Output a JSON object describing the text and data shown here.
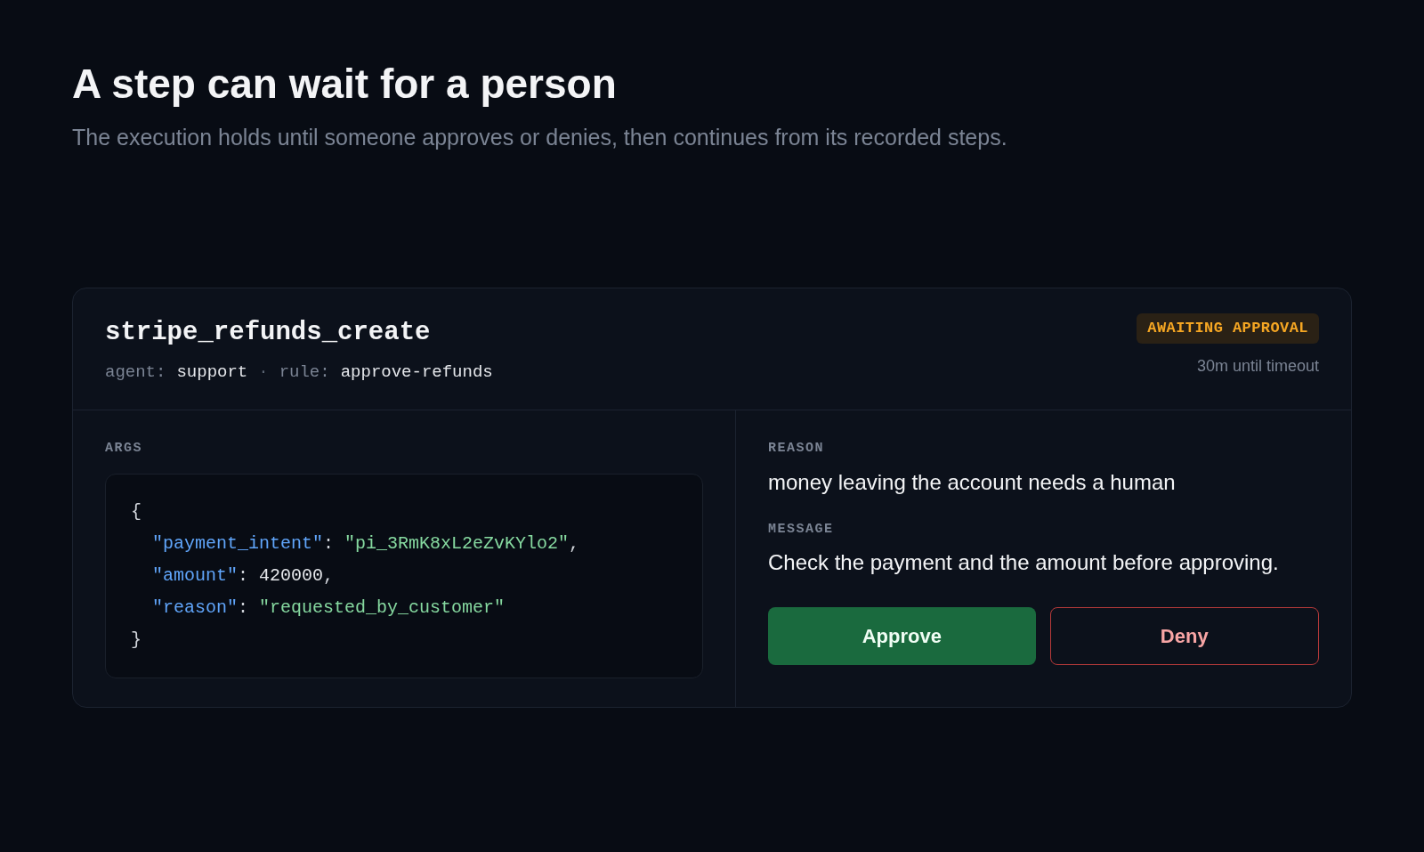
{
  "heading": "A step can wait for a person",
  "subheading": "The execution holds until someone approves or denies, then continues from its recorded steps.",
  "card": {
    "tool": "stripe_refunds_create",
    "meta": [
      {
        "label": "agent:",
        "value": "support"
      },
      {
        "label": "rule:",
        "value": "approve-refunds"
      }
    ],
    "meta_separator": "·",
    "status": {
      "label": "AWAITING APPROVAL",
      "kind": "pending"
    },
    "timeout": "30m until timeout",
    "args_label": "ARGS",
    "args_lines": [
      {
        "indent": false,
        "tokens": [
          {
            "text": "{",
            "kind": "punct"
          }
        ]
      },
      {
        "indent": true,
        "tokens": [
          {
            "text": "\"payment_intent\"",
            "kind": "key"
          },
          {
            "text": ": ",
            "kind": "punct"
          },
          {
            "text": "\"pi_3RmK8xL2eZvKYlo2\"",
            "kind": "string"
          },
          {
            "text": ",",
            "kind": "punct"
          }
        ]
      },
      {
        "indent": true,
        "tokens": [
          {
            "text": "\"amount\"",
            "kind": "key"
          },
          {
            "text": ": ",
            "kind": "punct"
          },
          {
            "text": "420000",
            "kind": "number"
          },
          {
            "text": ",",
            "kind": "punct"
          }
        ]
      },
      {
        "indent": true,
        "tokens": [
          {
            "text": "\"reason\"",
            "kind": "key"
          },
          {
            "text": ": ",
            "kind": "punct"
          },
          {
            "text": "\"requested_by_customer\"",
            "kind": "string"
          }
        ]
      },
      {
        "indent": false,
        "tokens": [
          {
            "text": "}",
            "kind": "punct"
          }
        ]
      }
    ],
    "fields": [
      {
        "label": "REASON",
        "text": "money leaving the account needs a human"
      },
      {
        "label": "MESSAGE",
        "text": "Check the payment and the amount before approving."
      }
    ],
    "actions": [
      {
        "label": "Approve",
        "kind": "primary"
      },
      {
        "label": "Deny",
        "kind": "danger"
      }
    ]
  }
}
